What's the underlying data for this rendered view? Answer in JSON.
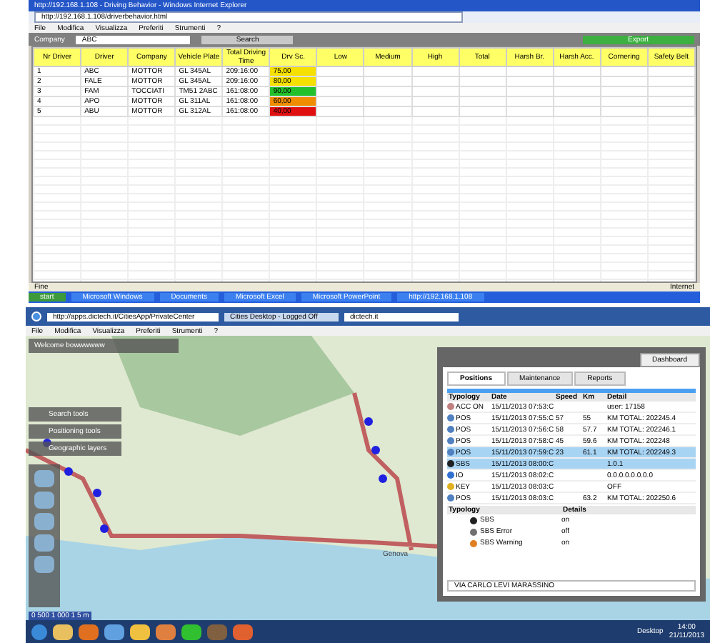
{
  "top_window": {
    "title": "http://192.168.1.108 - Driving Behavior - Windows Internet Explorer",
    "address": "http://192.168.1.108/driverbehavior.html",
    "menu": [
      "File",
      "Modifica",
      "Visualizza",
      "Preferiti",
      "Strumenti",
      "?"
    ],
    "filter_label": "Company",
    "filter_value": "ABC",
    "search_button": "Search",
    "export_button": "Export",
    "columns": [
      "Nr Driver",
      "Driver",
      "Company",
      "Vehicle Plate",
      "Total Driving Time",
      "Drv Sc.",
      "Low",
      "Medium",
      "High",
      "Total",
      "Harsh Br.",
      "Harsh Acc.",
      "Cornering",
      "Safety Belt"
    ],
    "rows": [
      {
        "cells": [
          "1",
          "ABC",
          "MOTTOR",
          "GL 345AL",
          "209:16:00"
        ],
        "score": "75,00",
        "color": "#f5e000"
      },
      {
        "cells": [
          "2",
          "FALE",
          "MOTTOR",
          "GL 345AL",
          "209:16:00"
        ],
        "score": "80,00",
        "color": "#f5e000"
      },
      {
        "cells": [
          "3",
          "FAM",
          "TOCCIATI",
          "TM51 2ABC",
          "161:08:00"
        ],
        "score": "90,00",
        "color": "#22c02a"
      },
      {
        "cells": [
          "4",
          "APO",
          "MOTTOR",
          "GL 311AL",
          "161:08:00"
        ],
        "score": "60,00",
        "color": "#f08c00"
      },
      {
        "cells": [
          "5",
          "ABU",
          "MOTTOR",
          "GL 312AL",
          "161:08:00"
        ],
        "score": "40,00",
        "color": "#e01010"
      }
    ],
    "status": "Fine",
    "zone": "Internet",
    "taskbar": [
      "start",
      "Microsoft Windows",
      "Documents",
      "Microsoft Excel",
      "Microsoft PowerPoint",
      "http://192.168.1.108"
    ]
  },
  "bottom_window": {
    "address": "http://apps.dictech.it/CitiesApp/PrivateCenter",
    "tabs": [
      {
        "label": "Cities Desktop - Logged Off",
        "selected": false
      },
      {
        "label": "dictech.it",
        "selected": true
      }
    ],
    "menu": [
      "File",
      "Modifica",
      "Visualizza",
      "Preferiti",
      "Strumenti",
      "?"
    ],
    "welcome": "Welcome bowwwwww",
    "tools": [
      "Search tools",
      "Positioning tools",
      "Geographic layers"
    ],
    "map_labels": [
      "Genova"
    ],
    "scale": "0 500 1 000 1 5 m",
    "dashboard_button": "Dashboard",
    "panel_tabs": [
      {
        "label": "Positions",
        "selected": true
      },
      {
        "label": "Maintenance",
        "selected": false
      },
      {
        "label": "Reports",
        "selected": false
      }
    ],
    "columns": [
      "Typology",
      "Date",
      "Speed",
      "Km",
      "Detail"
    ],
    "events": [
      {
        "kind": "acc",
        "type": "ACC ON",
        "date": "15/11/2013 07:53:C",
        "detail": "user: 17158",
        "selected": false
      },
      {
        "kind": "pos",
        "type": "POS",
        "date": "15/11/2013 07:55:C",
        "speed": "57",
        "km": "55",
        "detail": "KM TOTAL: 202245.4",
        "selected": false
      },
      {
        "kind": "pos",
        "type": "POS",
        "date": "15/11/2013 07:56:C",
        "speed": "58",
        "km": "57.7",
        "detail": "KM TOTAL: 202246.1",
        "selected": false
      },
      {
        "kind": "pos",
        "type": "POS",
        "date": "15/11/2013 07:58:C",
        "speed": "45",
        "km": "59.6",
        "detail": "KM TOTAL: 202248",
        "selected": false
      },
      {
        "kind": "pos",
        "type": "POS",
        "date": "15/11/2013 07:59:C",
        "speed": "23",
        "km": "61.1",
        "detail": "KM TOTAL: 202249.3",
        "selected": true
      },
      {
        "kind": "sbs",
        "type": "SBS",
        "date": "15/11/2013 08:00:C",
        "detail": "1.0.1",
        "selected": true
      },
      {
        "kind": "io",
        "type": "IO",
        "date": "15/11/2013 08:02:C",
        "detail": "0.0.0.0.0.0.0.0",
        "selected": false
      },
      {
        "kind": "key",
        "type": "KEY",
        "date": "15/11/2013 08:03:C",
        "detail": "OFF",
        "selected": false
      },
      {
        "kind": "pos",
        "type": "POS",
        "date": "15/11/2013 08:03:C",
        "km": "63.2",
        "detail": "KM TOTAL: 202250.6",
        "selected": false
      }
    ],
    "detail_columns": [
      "Typology",
      "Details"
    ],
    "details": [
      {
        "kind": "sbs",
        "name": "SBS",
        "value": "on"
      },
      {
        "kind": "error",
        "name": "SBS Error",
        "value": "off"
      },
      {
        "kind": "warning",
        "name": "SBS Warning",
        "value": "on"
      }
    ],
    "address_line": "VIA CARLO LEVI MARASSINO",
    "desktop": "Desktop",
    "time": "14:00",
    "date": "21/11/2013"
  }
}
